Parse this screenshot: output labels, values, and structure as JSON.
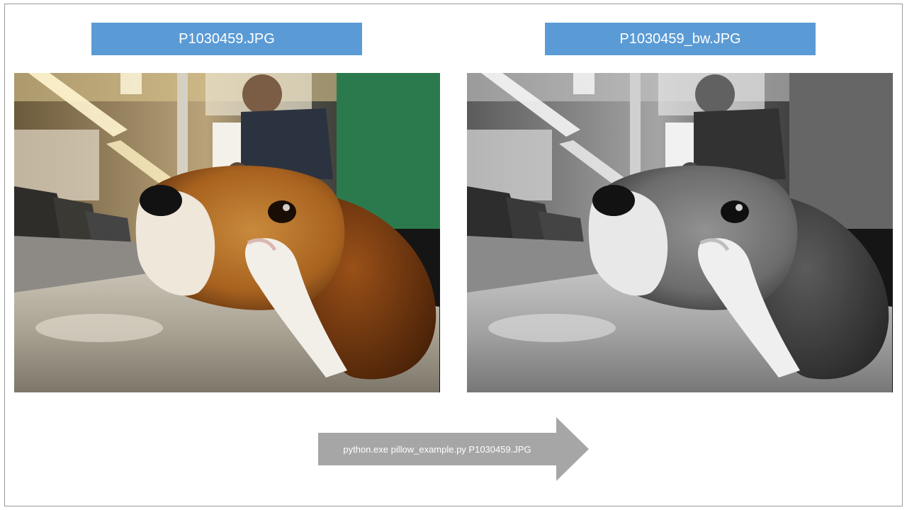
{
  "slide": {
    "original_label": "P1030459.JPG",
    "converted_label": "P1030459_bw.JPG",
    "command": "python.exe pillow_example.py P1030459.JPG"
  },
  "colors": {
    "label_background": "#5b9bd5",
    "arrow_fill": "#a6a6a6"
  },
  "images": {
    "original": "beagle-photo-color",
    "converted": "beagle-photo-grayscale"
  }
}
